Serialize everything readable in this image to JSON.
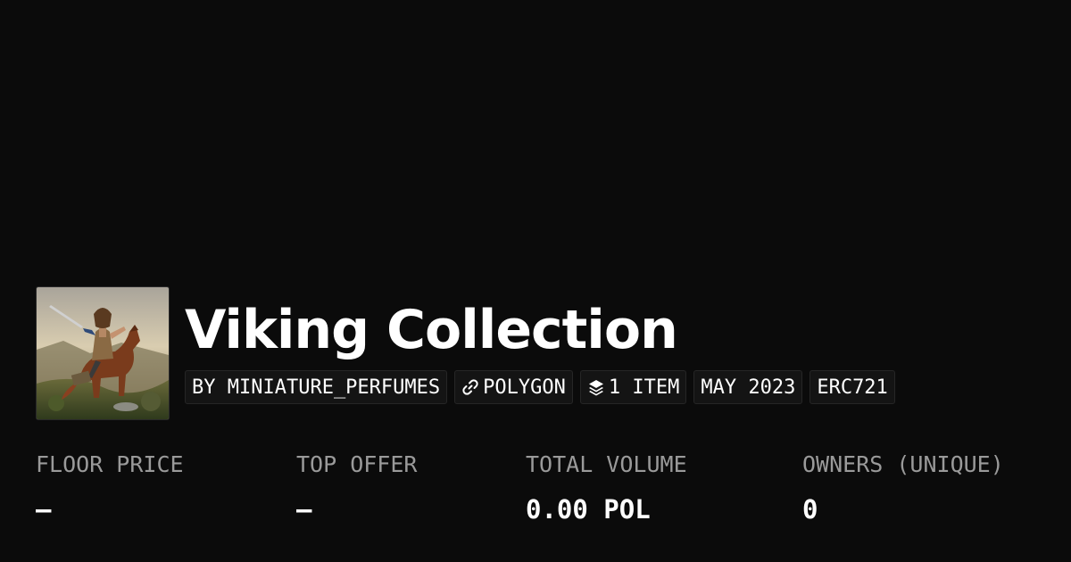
{
  "collection": {
    "title": "Viking Collection",
    "avatar_alt": "Viking warrior on horseback raising a sword"
  },
  "badges": {
    "creator": "BY MINIATURE_PERFUMES",
    "chain": "POLYGON",
    "chain_icon": "link-icon",
    "items": "1 ITEM",
    "items_icon": "layers-icon",
    "date": "MAY 2023",
    "standard": "ERC721"
  },
  "stats": {
    "floor_price": {
      "label": "FLOOR PRICE",
      "value": "–"
    },
    "top_offer": {
      "label": "TOP OFFER",
      "value": "–"
    },
    "total_volume": {
      "label": "TOTAL VOLUME",
      "value": "0.00 POL"
    },
    "owners": {
      "label": "OWNERS (UNIQUE)",
      "value": "0"
    }
  },
  "colors": {
    "background": "#0b0b0b",
    "text": "#ffffff",
    "muted": "#9a9a9a"
  }
}
